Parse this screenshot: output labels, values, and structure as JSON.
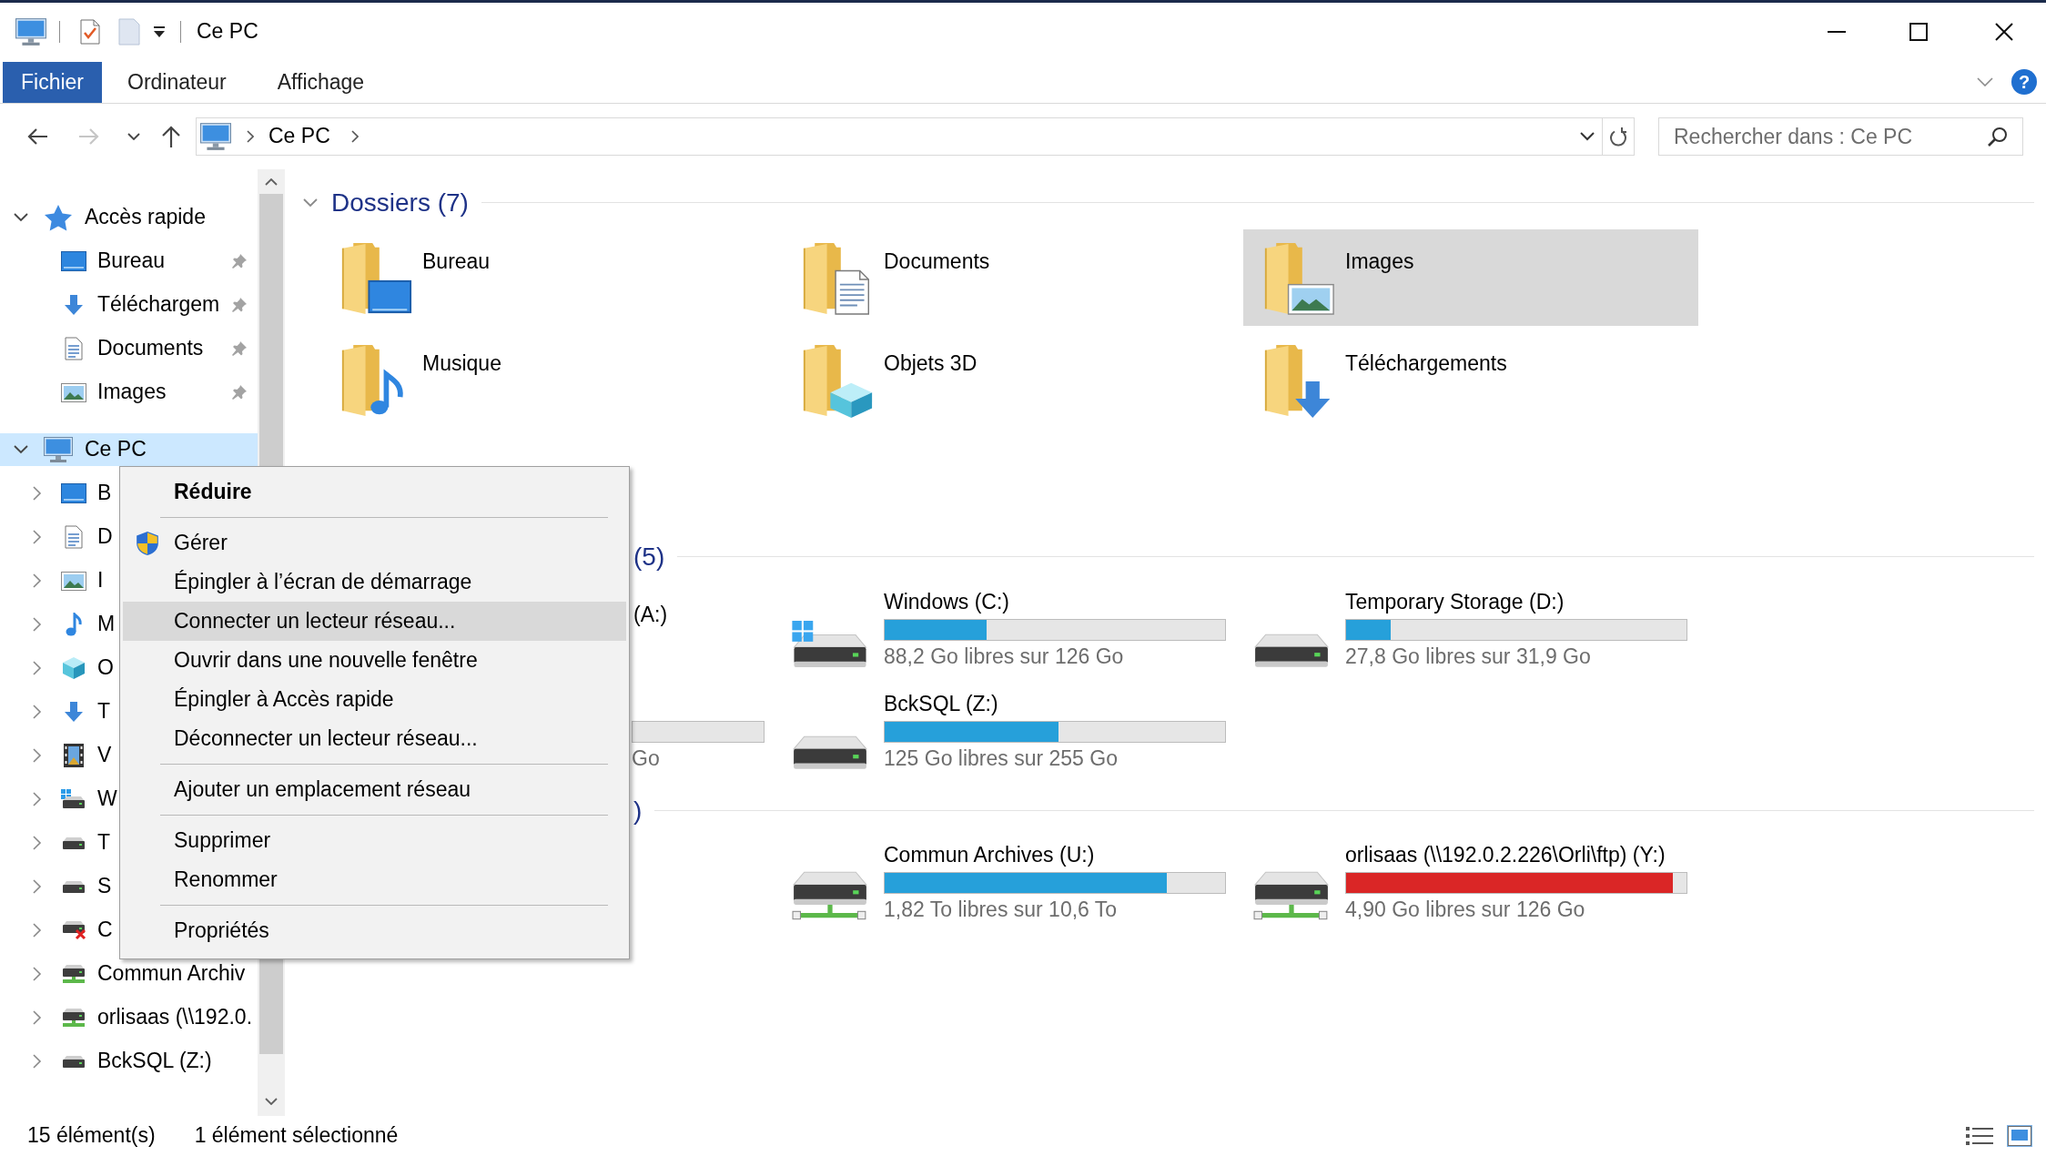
{
  "window": {
    "title": "Ce PC"
  },
  "ribbon": {
    "tabs": [
      {
        "label": "Fichier",
        "kind": "file"
      },
      {
        "label": "Ordinateur",
        "kind": "tab"
      },
      {
        "label": "Affichage",
        "kind": "tab"
      }
    ],
    "help": "?"
  },
  "navigation": {
    "buttons": [
      {
        "kind": "back",
        "disabled": false
      },
      {
        "kind": "forward",
        "disabled": true
      },
      {
        "kind": "recent",
        "disabled": false
      },
      {
        "kind": "up",
        "disabled": false
      }
    ]
  },
  "address_bar": {
    "path": [
      "Ce PC"
    ]
  },
  "search": {
    "placeholder": "Rechercher dans : Ce PC"
  },
  "sidebar": {
    "items": [
      {
        "label": "Accès rapide",
        "kind": "star",
        "expanded": true,
        "selected": false,
        "children": [
          {
            "label": "Bureau",
            "kind": "desktop",
            "pinned": true,
            "selected": false
          },
          {
            "label": "Téléchargem",
            "kind": "downloads",
            "pinned": true,
            "selected": false
          },
          {
            "label": "Documents",
            "kind": "documents",
            "pinned": true,
            "selected": false
          },
          {
            "label": "Images",
            "kind": "pictures",
            "pinned": true,
            "selected": false
          }
        ]
      },
      {
        "label": "Ce PC",
        "kind": "computer",
        "expanded": true,
        "selected": true,
        "children": [
          {
            "label": "B",
            "kind": "desktop",
            "expanded": false,
            "selected": false
          },
          {
            "label": "D",
            "kind": "documents",
            "expanded": false,
            "selected": false
          },
          {
            "label": "I",
            "kind": "pictures",
            "expanded": false,
            "selected": false
          },
          {
            "label": "M",
            "kind": "music",
            "expanded": false,
            "selected": false
          },
          {
            "label": "O",
            "kind": "objects",
            "expanded": false,
            "selected": false
          },
          {
            "label": "T",
            "kind": "downloads",
            "expanded": false,
            "selected": false
          },
          {
            "label": "V",
            "kind": "videos",
            "expanded": false,
            "selected": false
          },
          {
            "label": "W",
            "kind": "systemdrive",
            "expanded": false,
            "selected": false
          },
          {
            "label": "T",
            "kind": "drive",
            "expanded": false,
            "selected": false
          },
          {
            "label": "S",
            "kind": "drive",
            "expanded": false,
            "selected": false
          },
          {
            "label": "C",
            "kind": "disconnected",
            "expanded": false,
            "selected": false
          },
          {
            "label": "Commun Archiv",
            "kind": "netdrive",
            "expanded": false,
            "selected": false
          },
          {
            "label": "orlisaas (\\\\192.0.",
            "kind": "netdrive",
            "expanded": false,
            "selected": false
          },
          {
            "label": "BckSQL (Z:)",
            "kind": "drive",
            "expanded": false,
            "selected": false
          }
        ]
      }
    ]
  },
  "content": {
    "sections": [
      {
        "kind": "folders",
        "header": {
          "text": "Dossiers (7)",
          "kind": "full",
          "expanded": true
        },
        "items": [
          {
            "name": "Bureau",
            "kind": "desktop",
            "selected": false
          },
          {
            "name": "Documents",
            "kind": "documents",
            "selected": false
          },
          {
            "name": "Images",
            "kind": "pictures",
            "selected": true
          },
          {
            "name": "Musique",
            "kind": "music",
            "selected": false
          },
          {
            "name": "Objets 3D",
            "kind": "objects",
            "selected": false
          },
          {
            "name": "Téléchargements",
            "kind": "downloads",
            "selected": false
          }
        ]
      },
      {
        "kind": "drives",
        "header": {
          "text": "(5)",
          "kind": "clipped"
        },
        "items": [
          {
            "kind": "clipped",
            "name": "(A:)"
          },
          {
            "kind": "system",
            "name": "Windows (C:)",
            "level": 0.3,
            "free": "88,2 Go libres sur 126 Go"
          },
          {
            "kind": "disk",
            "name": "Temporary Storage (D:)",
            "level": 0.13,
            "free": "27,8 Go libres sur 31,9 Go"
          },
          {
            "kind": "clipped",
            "free": "Go"
          },
          {
            "kind": "disk",
            "name": "BckSQL (Z:)",
            "level": 0.51,
            "free": "125 Go libres sur 255 Go"
          }
        ]
      },
      {
        "kind": "network",
        "header": {
          "text": ")",
          "kind": "clipped"
        },
        "items": [
          {
            "kind": "network",
            "name": "Commun Archives (U:)",
            "level": 0.83,
            "free": "1,82 To libres sur 10,6 To"
          },
          {
            "kind": "network",
            "name": "orlisaas (\\\\192.0.2.226\\Orli\\ftp) (Y:)",
            "level": 0.96,
            "free": "4,90 Go libres sur 126 Go"
          }
        ]
      }
    ]
  },
  "context_menu": {
    "items": [
      {
        "kind": "default",
        "label": "Réduire",
        "selected": false
      },
      {
        "kind": "separator"
      },
      {
        "kind": "admin",
        "label": "Gérer",
        "selected": false
      },
      {
        "kind": "command",
        "label": "Épingler à l’écran de démarrage",
        "selected": false
      },
      {
        "kind": "command",
        "label": "Connecter un lecteur réseau...",
        "selected": true
      },
      {
        "kind": "command",
        "label": "Ouvrir dans une nouvelle fenêtre",
        "selected": false
      },
      {
        "kind": "command",
        "label": "Épingler à Accès rapide",
        "selected": false
      },
      {
        "kind": "command",
        "label": "Déconnecter un lecteur réseau...",
        "selected": false
      },
      {
        "kind": "separator"
      },
      {
        "kind": "command",
        "label": "Ajouter un emplacement réseau",
        "selected": false
      },
      {
        "kind": "separator"
      },
      {
        "kind": "command",
        "label": "Supprimer",
        "selected": false
      },
      {
        "kind": "command",
        "label": "Renommer",
        "selected": false
      },
      {
        "kind": "separator"
      },
      {
        "kind": "command",
        "label": "Propriétés",
        "selected": false
      }
    ]
  },
  "status_bar": {
    "item_count": "15 élément(s)",
    "selection": "1 élément sélectionné",
    "views": [
      {
        "kind": "details",
        "selected": false
      },
      {
        "kind": "tiles",
        "selected": true
      }
    ]
  }
}
